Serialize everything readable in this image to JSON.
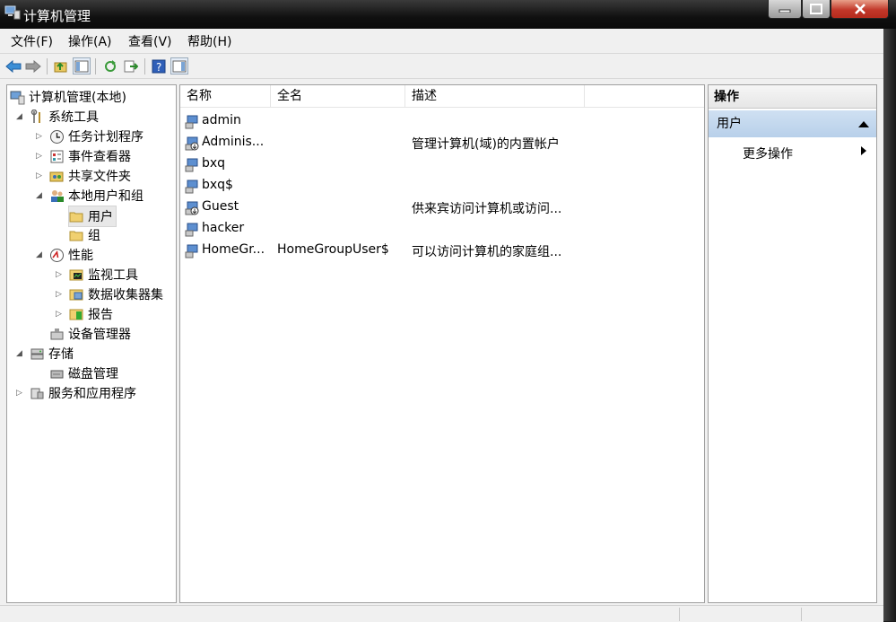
{
  "window": {
    "title": "计算机管理"
  },
  "menu": [
    "文件(F)",
    "操作(A)",
    "查看(V)",
    "帮助(H)"
  ],
  "tree": {
    "root": "计算机管理(本地)",
    "system_tools": "系统工具",
    "task_scheduler": "任务计划程序",
    "event_viewer": "事件查看器",
    "shared_folders": "共享文件夹",
    "local_users_groups": "本地用户和组",
    "users": "用户",
    "groups": "组",
    "performance": "性能",
    "monitoring_tools": "监视工具",
    "data_collector_sets": "数据收集器集",
    "reports": "报告",
    "device_manager": "设备管理器",
    "storage": "存储",
    "disk_management": "磁盘管理",
    "services_apps": "服务和应用程序"
  },
  "list": {
    "columns": [
      "名称",
      "全名",
      "描述"
    ],
    "rows": [
      {
        "name": "admin",
        "fullname": "",
        "desc": "",
        "disabled": false
      },
      {
        "name": "Adminis...",
        "fullname": "",
        "desc": "管理计算机(域)的内置帐户",
        "disabled": true
      },
      {
        "name": "bxq",
        "fullname": "",
        "desc": "",
        "disabled": false
      },
      {
        "name": "bxq$",
        "fullname": "",
        "desc": "",
        "disabled": false
      },
      {
        "name": "Guest",
        "fullname": "",
        "desc": "供来宾访问计算机或访问...",
        "disabled": true
      },
      {
        "name": "hacker",
        "fullname": "",
        "desc": "",
        "disabled": false
      },
      {
        "name": "HomeGr...",
        "fullname": "HomeGroupUser$",
        "desc": "可以访问计算机的家庭组...",
        "disabled": false
      }
    ]
  },
  "actions": {
    "header": "操作",
    "section": "用户",
    "more": "更多操作"
  },
  "colors": {
    "selection_blue": "#b8d0ea",
    "close_red": "#c2382a"
  }
}
